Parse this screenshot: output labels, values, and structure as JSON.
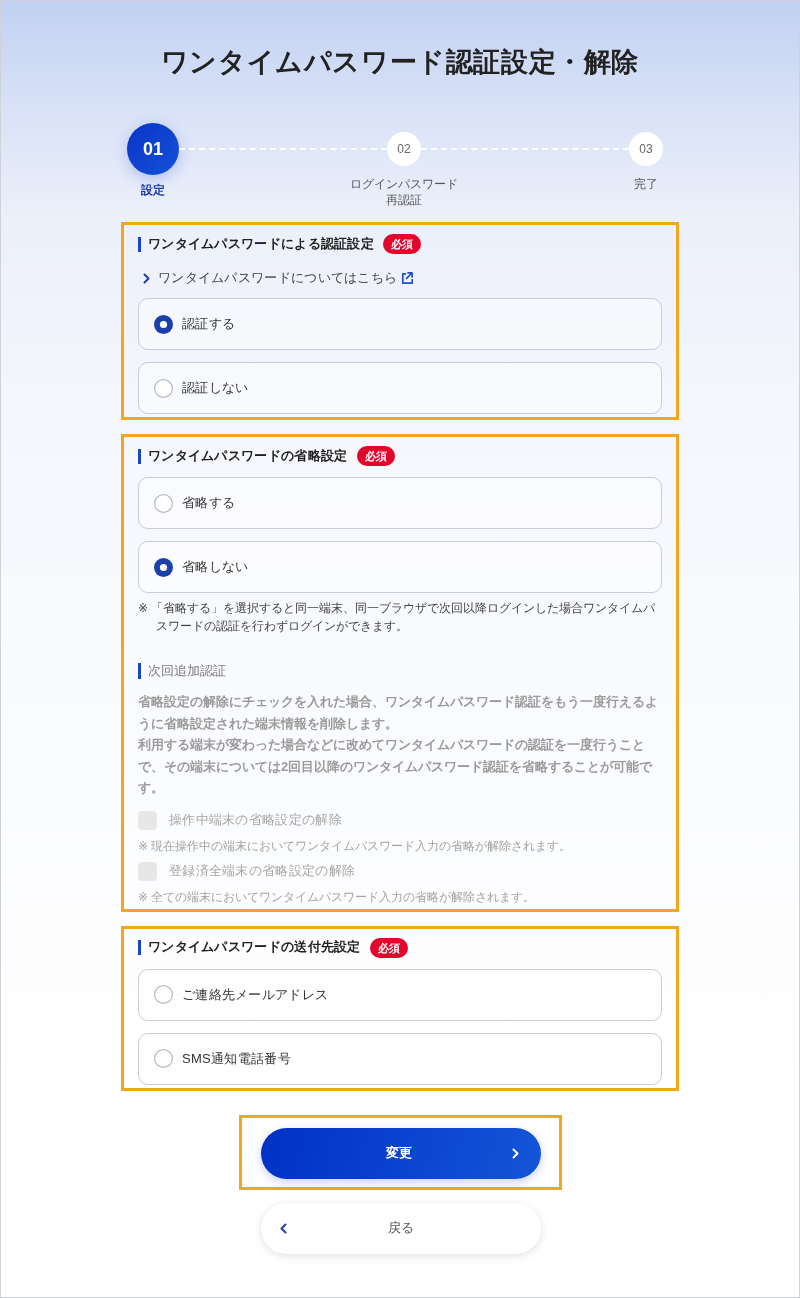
{
  "title": "ワンタイムパスワード認証設定・解除",
  "steps": [
    {
      "number": "01",
      "label": "設定",
      "selected": true
    },
    {
      "number": "02",
      "label": "ログインパスワード再認証",
      "selected": false
    },
    {
      "number": "03",
      "label": "完了",
      "selected": false
    }
  ],
  "sections": [
    {
      "heading": "ワンタイムパスワードによる認証設定",
      "badge": "必須",
      "highlighted": true,
      "link": {
        "text": "ワンタイムパスワードについてはこちら"
      },
      "options": [
        {
          "label": "認証する",
          "selected": true
        },
        {
          "label": "認証しない",
          "selected": false
        }
      ]
    },
    {
      "heading": "ワンタイムパスワードの省略設定",
      "badge": "必須",
      "highlighted": true,
      "options": [
        {
          "label": "省略する",
          "selected": false
        },
        {
          "label": "省略しない",
          "selected": true
        }
      ],
      "note": "※ 「省略する」を選択すると同一端末、同一ブラウザで次回以降ログインした場合ワンタイムパスワードの認証を行わずログインができます。",
      "subsection": {
        "heading": "次回追加認証",
        "disabled": true,
        "paragraphs": [
          "省略設定の解除にチェックを入れた場合、ワンタイムパスワード認証をもう一度行えるように省略設定された端末情報を削除します。",
          "利用する端末が変わった場合などに改めてワンタイムパスワードの認証を一度行うことで、その端末については2回目以降のワンタイムパスワード認証を省略することが可能です。"
        ],
        "checkboxes": [
          {
            "label": "操作中端末の省略設定の解除",
            "checked": false,
            "note": "※ 現在操作中の端末においてワンタイムパスワード入力の省略が解除されます。"
          },
          {
            "label": "登録済全端末の省略設定の解除",
            "checked": false,
            "note": "※ 全ての端末においてワンタイムパスワード入力の省略が解除されます。"
          }
        ]
      }
    },
    {
      "heading": "ワンタイムパスワードの送付先設定",
      "badge": "必須",
      "highlighted": true,
      "options": [
        {
          "label": "ご連絡先メールアドレス",
          "selected": false
        },
        {
          "label": "SMS通知電話番号",
          "selected": false
        }
      ]
    }
  ],
  "buttons": [
    {
      "kind": "primary",
      "label": "変更",
      "highlighted": true
    },
    {
      "kind": "back",
      "label": "戻る",
      "highlighted": false
    }
  ]
}
